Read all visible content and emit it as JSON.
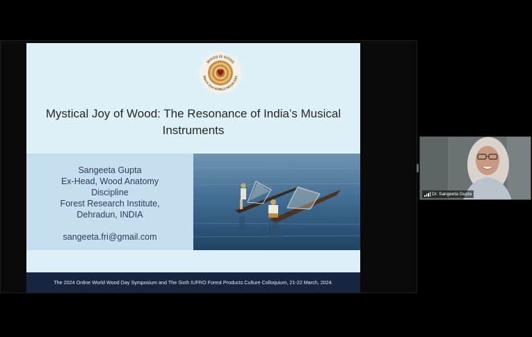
{
  "slide": {
    "logo": {
      "text_top": "WOOD IS GOOD",
      "text_bottom": "March 21st WORLD WOOD DAY",
      "icon": "heart-icon"
    },
    "title_line1": "Mystical Joy of Wood: The Resonance of India’s Musical",
    "title_line2": "Instruments",
    "author": {
      "name": "Sangeeta Gupta",
      "role_line1": "Ex-Head, Wood Anatomy",
      "role_line2": "Discipline",
      "institute_line1": "Forest Research Institute,",
      "institute_line2": "Dehradun, INDIA",
      "email": "sangeeta.fri@gmail.com"
    },
    "footer": "The 2024 Online World Wood Day Symposium and The Sixth IUFRO Forest Products Culture Colloquium, 21-22 March, 2024."
  },
  "participant": {
    "name": "Dr. Sangeeta Gupta",
    "icon": "signal-bars-icon"
  },
  "colors": {
    "background": "#000000",
    "slide_bg": "#dff1f8",
    "author_panel": "#c6dff0",
    "footer_bar": "#172540",
    "author_text": "#2c3d53"
  }
}
